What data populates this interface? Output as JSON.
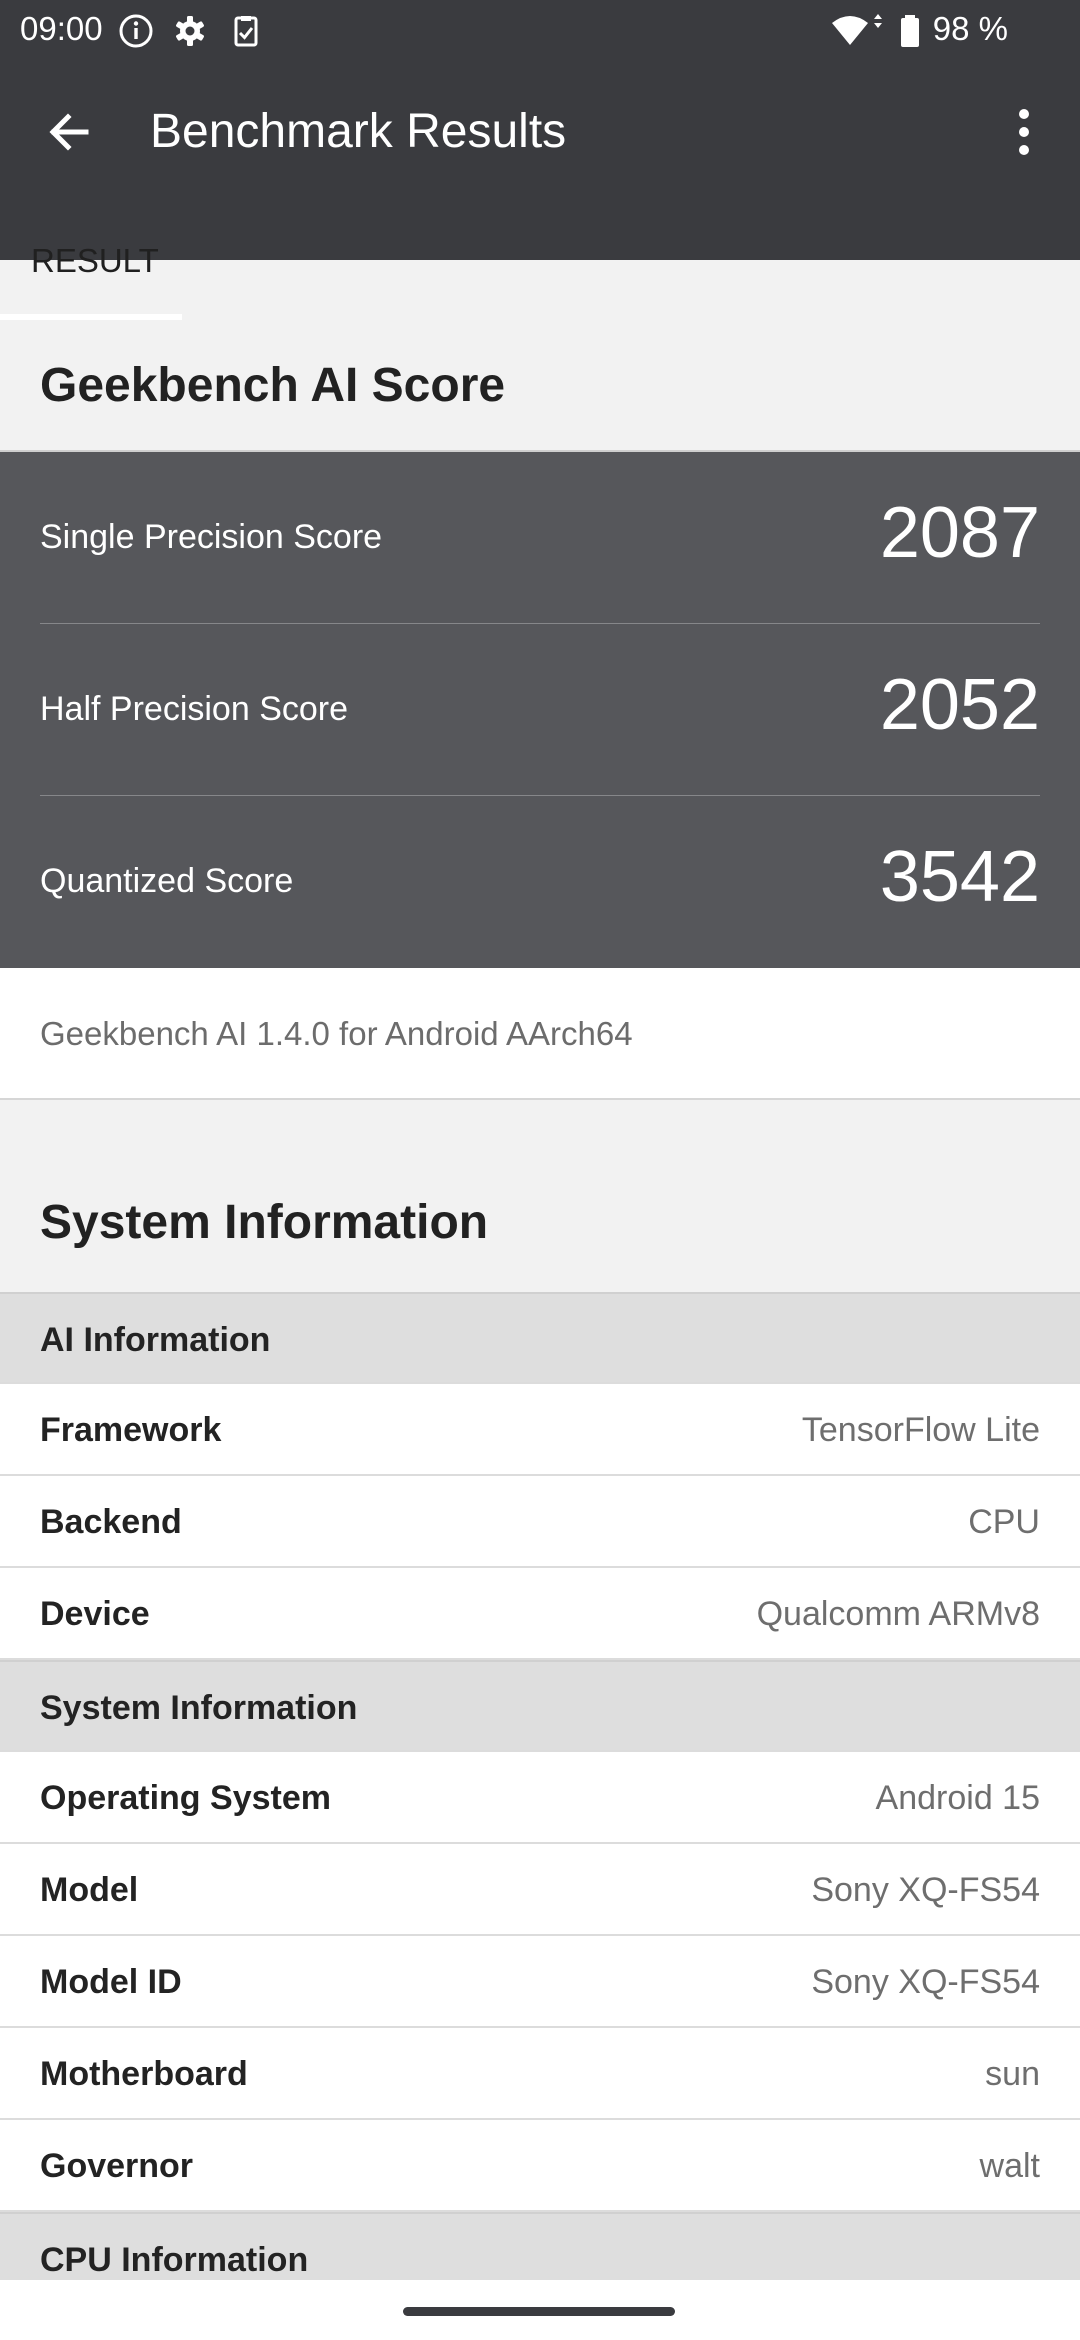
{
  "status_bar": {
    "time": "09:00",
    "icons": [
      "info-icon",
      "settings-gear-icon",
      "clipboard-check-icon",
      "wifi-icon",
      "battery-icon"
    ],
    "battery": "98 %"
  },
  "app_bar": {
    "title": "Benchmark Results",
    "tabs": [
      "RESULT"
    ],
    "bg_color": "#3a3b3f"
  },
  "score_section": {
    "heading": "Geekbench AI Score",
    "scores": [
      {
        "label": "Single Precision Score",
        "value": "2087"
      },
      {
        "label": "Half Precision Score",
        "value": "2052"
      },
      {
        "label": "Quantized Score",
        "value": "3542"
      }
    ],
    "version": "Geekbench AI 1.4.0 for Android AArch64",
    "box_color": "#56575b"
  },
  "system_section": {
    "heading": "System Information",
    "rows": [
      {
        "type": "group",
        "label": "AI Information"
      },
      {
        "type": "item",
        "key": "Framework",
        "value": "TensorFlow Lite"
      },
      {
        "type": "item",
        "key": "Backend",
        "value": "CPU"
      },
      {
        "type": "item",
        "key": "Device",
        "value": "Qualcomm ARMv8"
      },
      {
        "type": "group",
        "label": "System Information"
      },
      {
        "type": "item",
        "key": "Operating System",
        "value": "Android 15"
      },
      {
        "type": "item",
        "key": "Model",
        "value": "Sony XQ-FS54"
      },
      {
        "type": "item",
        "key": "Model ID",
        "value": "Sony XQ-FS54"
      },
      {
        "type": "item",
        "key": "Motherboard",
        "value": "sun"
      },
      {
        "type": "item",
        "key": "Governor",
        "value": "walt"
      },
      {
        "type": "group",
        "label": "CPU Information"
      }
    ]
  }
}
